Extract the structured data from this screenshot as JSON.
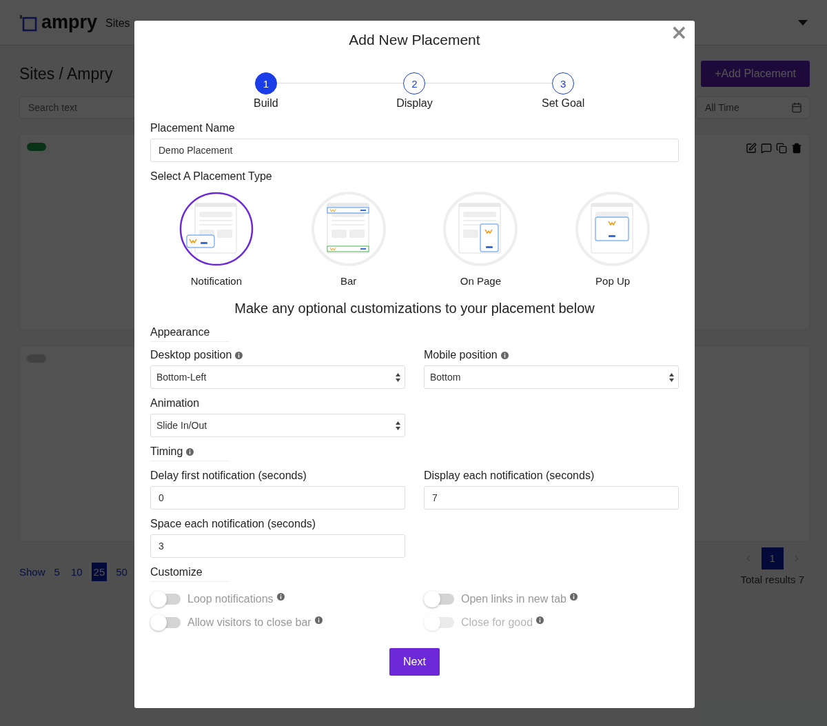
{
  "app": {
    "logo": "ampry",
    "nav": [
      {
        "label": "Sites"
      }
    ]
  },
  "page": {
    "breadcrumb": "Sites / Ampry",
    "add_button": "+Add Placement",
    "search": {
      "placeholder": "Search text"
    },
    "date_filter": {
      "value": "All Time"
    },
    "cards": [
      {
        "on": true
      },
      {
        "on": false
      }
    ],
    "pagination": {
      "show_label": "Show",
      "sizes": [
        {
          "label": "5",
          "selected": false
        },
        {
          "label": "10",
          "selected": false
        },
        {
          "label": "25",
          "selected": true
        },
        {
          "label": "50",
          "selected": false
        }
      ],
      "pages": [
        {
          "label": "1",
          "selected": true
        }
      ],
      "total": "Total results 7"
    }
  },
  "modal": {
    "title": "Add New Placement",
    "close": "×",
    "steps": [
      {
        "number": "1",
        "label": "Build",
        "selected": true
      },
      {
        "number": "2",
        "label": "Display",
        "selected": false
      },
      {
        "number": "3",
        "label": "Set Goal",
        "selected": false
      }
    ],
    "placement_name": {
      "label": "Placement Name",
      "value": "Demo Placement"
    },
    "type_label": "Select A Placement Type",
    "types": [
      {
        "kind": "notification",
        "label": "Notification",
        "selected": true
      },
      {
        "kind": "bar",
        "label": "Bar",
        "selected": false
      },
      {
        "kind": "on_page",
        "label": "On Page",
        "selected": false
      },
      {
        "kind": "popup",
        "label": "Pop Up",
        "selected": false
      }
    ],
    "customize_heading": "Make any optional customizations to your placement below",
    "appearance": {
      "heading": "Appearance",
      "desktop": {
        "label": "Desktop position",
        "info": true,
        "value": "Bottom-Left"
      },
      "mobile": {
        "label": "Mobile position",
        "info": true,
        "value": "Bottom"
      },
      "animation": {
        "label": "Animation",
        "info": false,
        "value": "Slide In/Out"
      }
    },
    "timing": {
      "heading": "Timing",
      "info": true,
      "delay": {
        "label": "Delay first notification (seconds)",
        "value": "0"
      },
      "display": {
        "label": "Display each notification (seconds)",
        "value": "7"
      },
      "space": {
        "label": "Space each notification (seconds)",
        "value": "3"
      }
    },
    "customize": {
      "heading": "Customize",
      "toggles": [
        {
          "label": "Loop notifications",
          "on": false,
          "disabled": false
        },
        {
          "label": "Open links in new tab",
          "on": false,
          "disabled": false
        },
        {
          "label": "Allow visitors to close bar",
          "on": false,
          "disabled": false
        },
        {
          "label": "Close for good",
          "on": false,
          "disabled": true
        }
      ]
    },
    "next": "Next"
  }
}
